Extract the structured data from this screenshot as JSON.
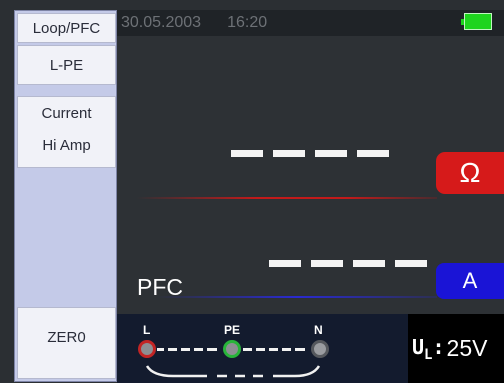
{
  "sidebar": {
    "mode": "Loop/PFC",
    "connection": "L-PE",
    "current_line1": "Current",
    "current_line2": "Hi Amp",
    "zero": "ZER0"
  },
  "header": {
    "date": "30.05.2003",
    "time": "16:20",
    "battery_icon": "battery-full-icon"
  },
  "readings": {
    "impedance_value": "----",
    "impedance_unit": "Ω",
    "pfc_label": "PFC",
    "pfc_value": "----",
    "pfc_unit": "A"
  },
  "connection_diagram": {
    "terminals": [
      "L",
      "PE",
      "N"
    ]
  },
  "limit": {
    "symbol": "U",
    "subscript": "L",
    "separator": ":",
    "value": "25V"
  },
  "colors": {
    "ohm_badge": "#d61a1a",
    "amp_badge": "#1a14d6",
    "battery": "#1ed41e",
    "sidebar_bg": "#c4cae8",
    "screen_bg": "#2d3135"
  }
}
